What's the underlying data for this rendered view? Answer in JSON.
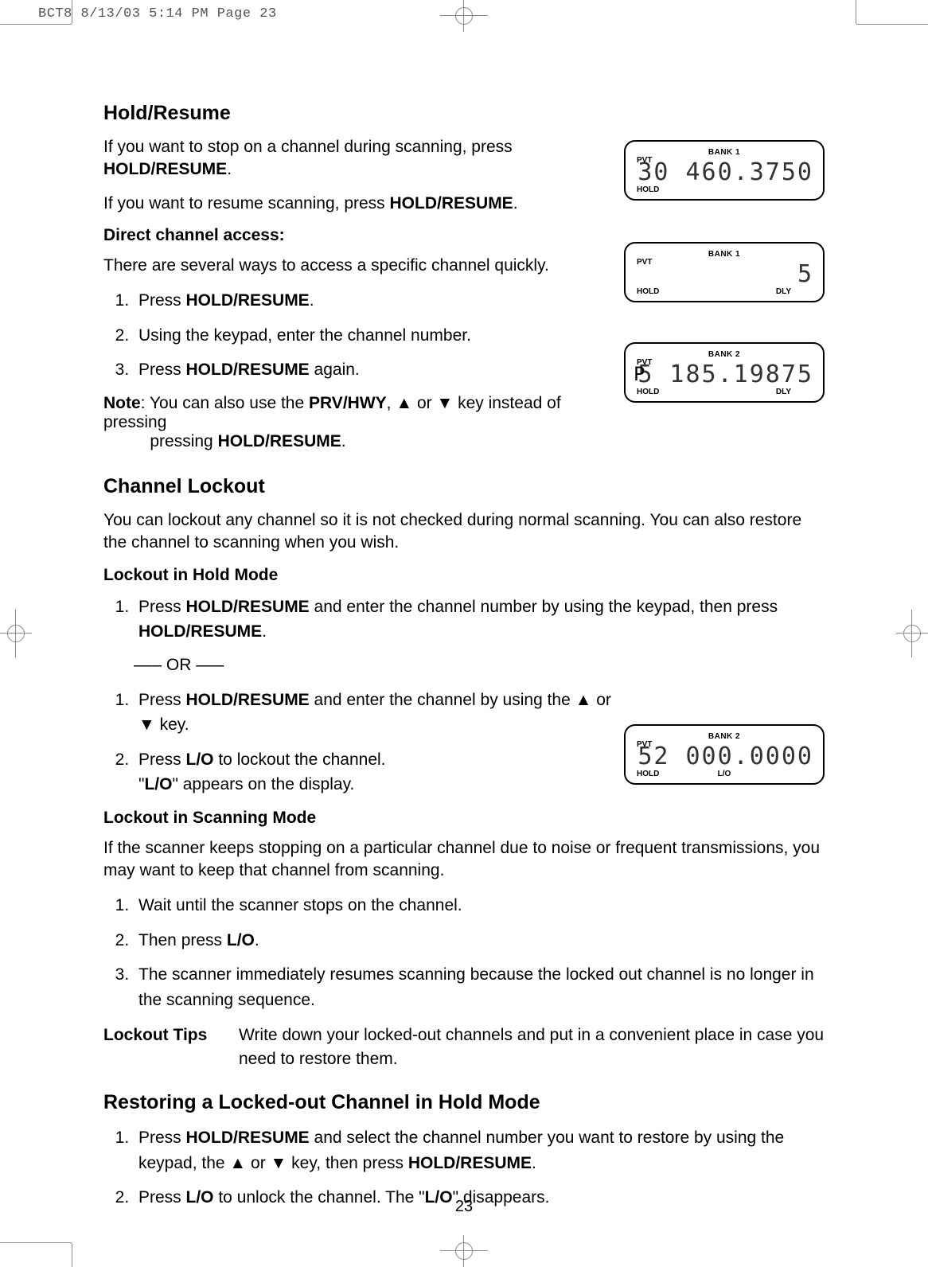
{
  "print_header": "BCT8  8/13/03 5:14 PM  Page 23",
  "page_number": "23",
  "sections": {
    "hold_resume": {
      "title": "Hold/Resume",
      "p1a": "If you want to stop on a channel during scanning, press ",
      "p1b": "HOLD/RESUME",
      "p1c": ".",
      "p2a": "If you want to resume scanning, press ",
      "p2b": "HOLD/RESUME",
      "p2c": ".",
      "direct_access": "Direct channel access:",
      "p3": "There are several ways to access a specific channel quickly.",
      "li1a": "Press ",
      "li1b": "HOLD/RESUME",
      "li1c": ".",
      "li2": "Using the keypad, enter the channel number.",
      "li3a": "Press ",
      "li3b": "HOLD/RESUME",
      "li3c": " again.",
      "note_label": "Note",
      "note_a": ":  You can also use the ",
      "note_b": "PRV/HWY",
      "note_c": ", ▲ or ▼ key instead of pressing ",
      "note_d": "HOLD/RESUME",
      "note_e": "."
    },
    "channel_lockout": {
      "title": "Channel Lockout",
      "p1": "You can lockout any channel so it is not checked during normal scanning. You can also restore the channel to scanning when you wish.",
      "sub1": "Lockout in Hold Mode",
      "li1a": "Press ",
      "li1b": "HOLD/RESUME",
      "li1c": " and enter the channel number by using the keypad, then press ",
      "li1d": "HOLD/RESUME",
      "li1e": ".",
      "or": "––– OR –––",
      "li2a": "Press ",
      "li2b": "HOLD/RESUME",
      "li2c": " and enter the channel by using the ▲ or ▼ key.",
      "li3a": "Press ",
      "li3b": "L/O",
      "li3c": " to lockout the channel.",
      "li3d": "\"",
      "li3e": "L/O",
      "li3f": "\" appears on the display.",
      "sub2": "Lockout in Scanning Mode",
      "p2": "If the scanner keeps stopping on a particular channel due to noise or frequent transmissions, you may want to keep that channel from scanning.",
      "s2li1": "Wait until the scanner stops on the channel.",
      "s2li2a": "Then press ",
      "s2li2b": "L/O",
      "s2li2c": ".",
      "s2li3": "The scanner immediately resumes scanning because the locked out channel is no longer in the scanning sequence.",
      "tips_label": "Lockout Tips",
      "tips_text": "Write down your locked-out channels and put in a convenient place in case you need to restore them."
    },
    "restoring": {
      "title": "Restoring a Locked-out Channel in Hold Mode",
      "li1a": "Press ",
      "li1b": "HOLD/RESUME",
      "li1c": " and select the channel number you want to restore by using the keypad, the ▲ or ▼ key, then press ",
      "li1d": "HOLD/RESUME",
      "li1e": ".",
      "li2a": "Press ",
      "li2b": "L/O",
      "li2c": " to unlock the channel. The \"",
      "li2d": "L/O",
      "li2e": "\" disappears."
    }
  },
  "lcd1": {
    "bank": "BANK 1",
    "pvt": "PVT",
    "hold": "HOLD",
    "digits": "30 460.3750"
  },
  "lcd2": {
    "bank": "BANK 1",
    "pvt": "PVT",
    "hold": "HOLD",
    "dly": "DLY",
    "digits": "5"
  },
  "lcd3": {
    "bank": "BANK   2",
    "pvt": "PVT",
    "hold": "HOLD",
    "dly": "DLY",
    "p": "P",
    "digits": "5 185.19875"
  },
  "lcd4": {
    "bank": "BANK   2",
    "pvt": "PVT",
    "hold": "HOLD",
    "lo": "L/O",
    "digits": "52 000.0000"
  }
}
